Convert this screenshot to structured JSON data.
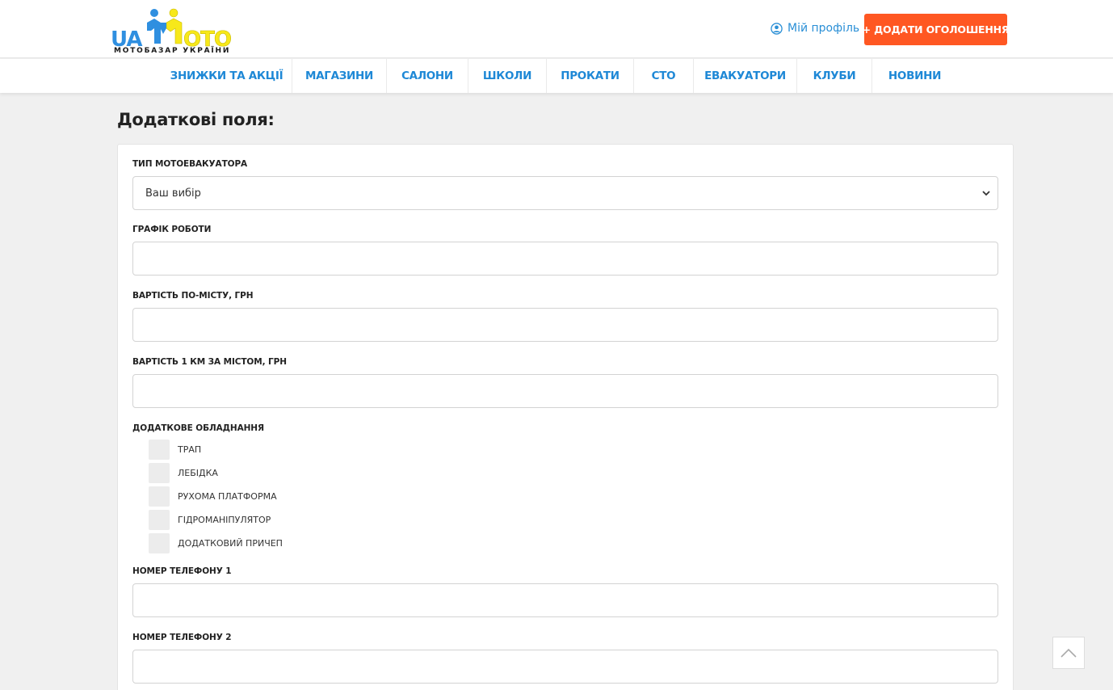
{
  "header": {
    "logo": {
      "ua": "UA",
      "oto": "OTO",
      "subtitle": "МОТОБАЗАР УКРАЇНИ"
    },
    "profile_label": "Мій профіль",
    "add_button_label": "+ ДОДАТИ ОГОЛОШЕННЯ"
  },
  "nav": {
    "items": [
      {
        "label": "ЗНИЖКИ ТА АКЦІЇ"
      },
      {
        "label": "МАГАЗИНИ"
      },
      {
        "label": "САЛОНИ"
      },
      {
        "label": "ШКОЛИ"
      },
      {
        "label": "ПРОКАТИ"
      },
      {
        "label": "СТО"
      },
      {
        "label": "ЕВАКУАТОРИ"
      },
      {
        "label": "КЛУБИ"
      },
      {
        "label": "НОВИНИ"
      }
    ]
  },
  "page": {
    "title": "Додаткові поля:"
  },
  "form": {
    "evacuator_type": {
      "label": "Тип мотоевакуатора",
      "value": "Ваш вибір"
    },
    "schedule": {
      "label": "Графік роботи",
      "value": ""
    },
    "city_price": {
      "label": "Вартість по-місту, грн",
      "value": ""
    },
    "km_price": {
      "label": "Вартість 1 км за містом, грн",
      "value": ""
    },
    "equipment": {
      "label": "Додаткове обладнання",
      "options": [
        {
          "label": "Трап",
          "checked": false
        },
        {
          "label": "Лебідка",
          "checked": false
        },
        {
          "label": "Рухома платформа",
          "checked": false
        },
        {
          "label": "Гідроманіпулятор",
          "checked": false
        },
        {
          "label": "Додатковий причеп",
          "checked": false
        }
      ]
    },
    "phone1": {
      "label": "Номер телефону 1",
      "value": ""
    },
    "phone2": {
      "label": "Номер телефону 2",
      "value": ""
    }
  },
  "colors": {
    "accent_blue": "#1e88d6",
    "add_button": "#ff5722",
    "logo_yellow": "#f7e81a",
    "logo_blue": "#2f8fe0"
  },
  "icons": {
    "profile": "user-circle-icon",
    "select": "chevron-down-icon",
    "scroll_top": "chevron-up-icon"
  }
}
